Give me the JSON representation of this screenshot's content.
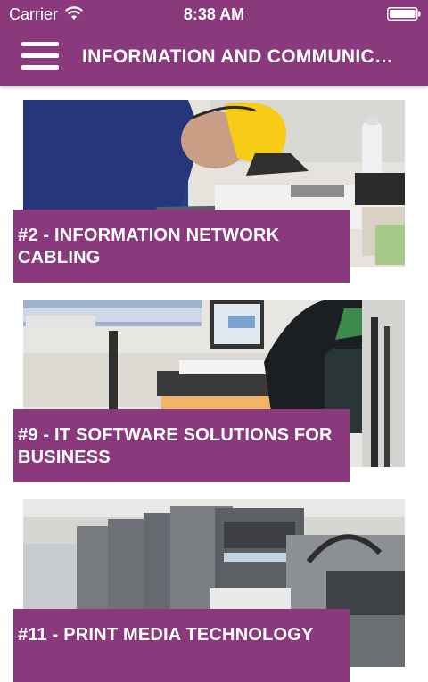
{
  "status_bar": {
    "carrier": "Carrier",
    "time": "8:38 AM"
  },
  "nav": {
    "title": "INFORMATION AND COMMUNIC…",
    "menu_icon": "hamburger-menu-icon"
  },
  "cards": [
    {
      "label": "#2 - INFORMATION NETWORK CABLING",
      "image": "worker in hard hat doing network cabling"
    },
    {
      "label": "#9 - IT SOFTWARE SOLUTIONS FOR BUSINESS",
      "image": "person working at a computer"
    },
    {
      "label": "#11 - PRINT MEDIA TECHNOLOGY",
      "image": "industrial printing press"
    }
  ],
  "colors": {
    "brand": "#8a3a7c",
    "text": "#ffffff"
  }
}
